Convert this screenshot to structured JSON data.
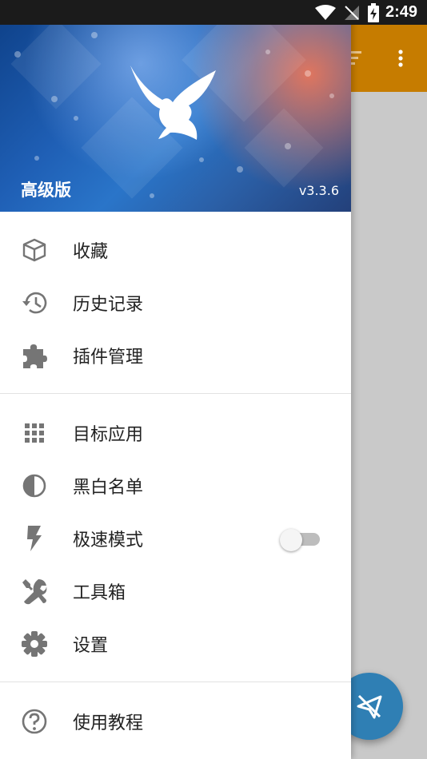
{
  "status_bar": {
    "time": "2:49"
  },
  "header": {
    "edition": "高级版",
    "version": "v3.3.6"
  },
  "menu_groups": [
    [
      {
        "label": "收藏",
        "icon": "box-icon"
      },
      {
        "label": "历史记录",
        "icon": "history-icon"
      },
      {
        "label": "插件管理",
        "icon": "puzzle-icon"
      }
    ],
    [
      {
        "label": "目标应用",
        "icon": "grid-icon"
      },
      {
        "label": "黑白名单",
        "icon": "contrast-icon"
      },
      {
        "label": "极速模式",
        "icon": "bolt-icon",
        "toggle": false
      },
      {
        "label": "工具箱",
        "icon": "tools-icon"
      },
      {
        "label": "设置",
        "icon": "gear-icon"
      }
    ],
    [
      {
        "label": "使用教程",
        "icon": "help-icon"
      }
    ]
  ],
  "colors": {
    "toolbar": "#c67c00",
    "fab": "#2f7fb4",
    "icon": "#757575"
  }
}
